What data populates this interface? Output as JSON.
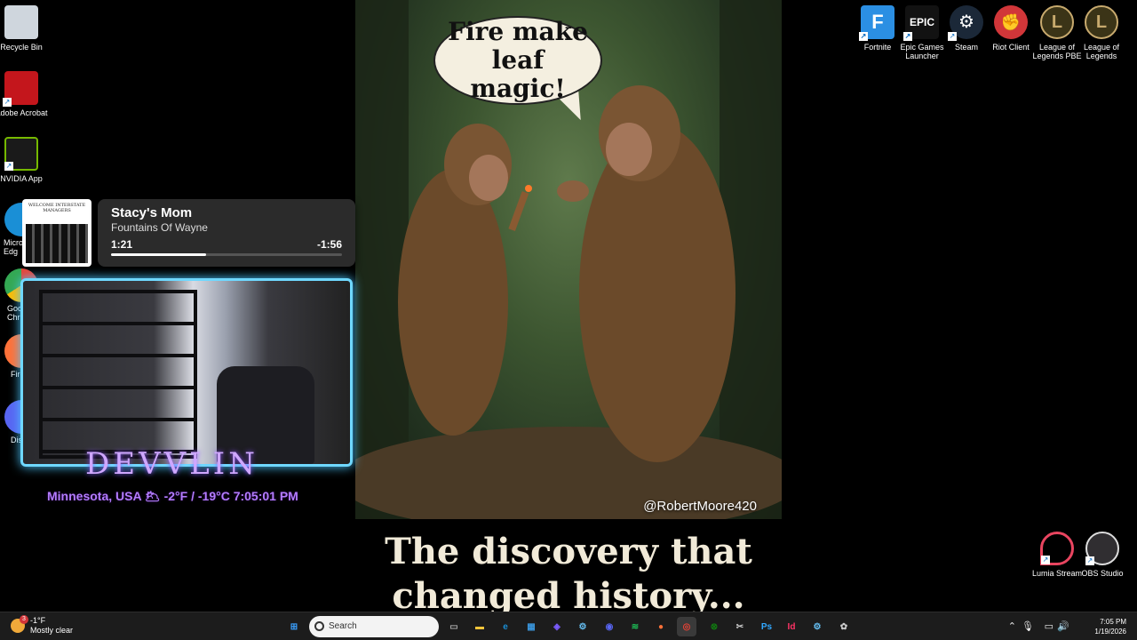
{
  "desktop_left": [
    {
      "label": "Recycle Bin",
      "icon": "recycle-bin-icon",
      "color": "#cfd6dd"
    },
    {
      "label": "Adobe Acrobat",
      "icon": "acrobat-icon",
      "color": "#c4161c"
    },
    {
      "label": "NVIDIA App",
      "icon": "nvidia-icon",
      "color": "#76b900"
    }
  ],
  "desktop_left_partial": [
    {
      "label": "Micro Edg",
      "icon": "edge-icon",
      "color": "#1a8fd6"
    },
    {
      "label": "Goo Chr",
      "icon": "chrome-icon",
      "color": "#e94235"
    },
    {
      "label": "Fire",
      "icon": "firefox-icon",
      "color": "#ff7139"
    },
    {
      "label": "Disc",
      "icon": "discord-icon",
      "color": "#5865f2"
    }
  ],
  "desktop_right": [
    {
      "label": "Fortnite",
      "icon": "fortnite-icon",
      "color": "#2b8fe3",
      "glyph": "F"
    },
    {
      "label": "Epic Games Launcher",
      "icon": "epic-games-icon",
      "color": "#121212",
      "glyph": "EPIC"
    },
    {
      "label": "Steam",
      "icon": "steam-icon",
      "color": "#1b2838",
      "glyph": "⚙"
    },
    {
      "label": "Riot Client",
      "icon": "riot-icon",
      "color": "#d13639",
      "glyph": "✊"
    },
    {
      "label": "League of Legends PBE",
      "icon": "league-pbe-icon",
      "color": "#3b3417",
      "glyph": "L"
    },
    {
      "label": "League of Legends",
      "icon": "league-icon",
      "color": "#3b3417",
      "glyph": "L"
    }
  ],
  "desktop_right_bottom": [
    {
      "label": "Lumia Stream",
      "icon": "lumia-stream-icon",
      "color": "#e94560"
    },
    {
      "label": "OBS Studio",
      "icon": "obs-icon",
      "color": "#302e31"
    }
  ],
  "meme": {
    "speech": "Fire make leaf magic!",
    "credit": "@RobertMoore420",
    "caption": "The discovery that changed history..."
  },
  "media": {
    "album_text": "WELCOME INTERSTATE MANAGERS",
    "song": "Stacy's Mom",
    "artist": "Fountains Of Wayne",
    "elapsed": "1:21",
    "remaining": "-1:56",
    "progress": 0.41
  },
  "overlay": {
    "brand": "DEVVLIN",
    "weather": "Minnesota, USA 🌥 -2°F / -19°C  7:05:01 PM"
  },
  "taskbar": {
    "weather_temp": "-1°F",
    "weather_desc": "Mostly clear",
    "weather_badge": "3",
    "search_placeholder": "Search",
    "apps": [
      {
        "name": "start-button",
        "glyph": "⊞",
        "color": "#3aa0ff"
      },
      {
        "name": "task-view-icon",
        "glyph": "▭",
        "color": "#aaaaaa"
      },
      {
        "name": "file-explorer-icon",
        "glyph": "▬",
        "color": "#f8c53a"
      },
      {
        "name": "edge-taskbar-icon",
        "glyph": "e",
        "color": "#1a8fd6"
      },
      {
        "name": "store-icon",
        "glyph": "▦",
        "color": "#3a96dd"
      },
      {
        "name": "copilot-icon",
        "glyph": "◈",
        "color": "#7b5cff"
      },
      {
        "name": "steam-taskbar-icon",
        "glyph": "⚙",
        "color": "#66c0f4"
      },
      {
        "name": "discord-taskbar-icon",
        "glyph": "◉",
        "color": "#5865f2"
      },
      {
        "name": "spotify-icon",
        "glyph": "≋",
        "color": "#1db954"
      },
      {
        "name": "firefox-taskbar-icon",
        "glyph": "●",
        "color": "#ff7139"
      },
      {
        "name": "chrome-taskbar-icon",
        "glyph": "◎",
        "color": "#e94235"
      },
      {
        "name": "xbox-icon",
        "glyph": "⊗",
        "color": "#107c10"
      },
      {
        "name": "snipping-icon",
        "glyph": "✂",
        "color": "#cccccc"
      },
      {
        "name": "photoshop-icon",
        "glyph": "Ps",
        "color": "#31a8ff"
      },
      {
        "name": "indesign-icon",
        "glyph": "Id",
        "color": "#ff3366"
      },
      {
        "name": "steam-taskbar-icon-2",
        "glyph": "⚙",
        "color": "#66c0f4"
      },
      {
        "name": "settings-icon",
        "glyph": "✿",
        "color": "#cccccc"
      }
    ],
    "time": "7:05 PM",
    "date": "1/19/2026"
  }
}
